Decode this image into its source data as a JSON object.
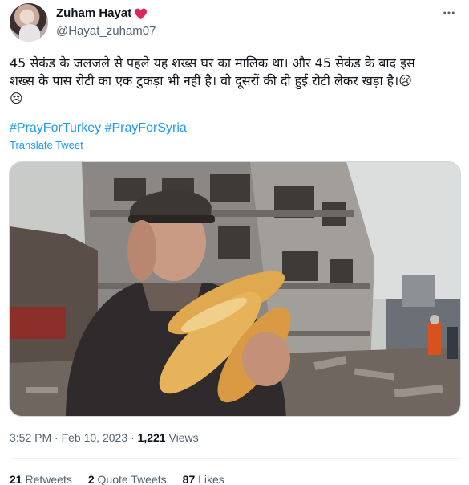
{
  "author": {
    "display_name": "Zuham Hayat",
    "handle": "@Hayat_zuham07"
  },
  "tweet": {
    "text_line1": "45 सेकंड के जलजले से पहले यह शख्स घर का मालिक था। और 45 सेकंड के बाद इस",
    "text_line2": "शख्स के पास रोटी का एक टुकड़ा भी नहीं है। वो दूसरों की दी हुई रोटी लेकर खड़ा है।😢",
    "text_line3": "😢",
    "hashtag1": "#PrayForTurkey",
    "hashtag2": "#PrayForSyria",
    "translate_label": "Translate Tweet"
  },
  "meta": {
    "time": "3:52 PM",
    "separator": "·",
    "date": "Feb 10, 2023",
    "views_count": "1,221",
    "views_label": "Views"
  },
  "stats": {
    "retweets_count": "21",
    "retweets_label": "Retweets",
    "quotes_count": "2",
    "quotes_label": "Quote Tweets",
    "likes_count": "87",
    "likes_label": "Likes"
  },
  "colors": {
    "link": "#1d9bf0",
    "secondary_text": "#536471",
    "heart": "#f91880"
  },
  "icons": {
    "more": "more-dots-icon",
    "heart": "red-heart-emoji"
  }
}
